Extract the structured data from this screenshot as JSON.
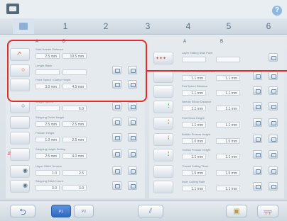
{
  "tabs": [
    {
      "label": "1"
    },
    {
      "label": "2"
    },
    {
      "label": "3"
    },
    {
      "label": "4"
    },
    {
      "label": "5"
    },
    {
      "label": "6"
    }
  ],
  "help_label": "?",
  "columns": {
    "a": "A",
    "b": "B"
  },
  "left_rows": [
    {
      "label": "Start Needle Distance",
      "a": "2.5 mm",
      "b": "10.5 mm"
    },
    {
      "label": "Length Blank",
      "a": "",
      "b": ""
    },
    {
      "label": "Feed Speed / Clamp Height",
      "a": "3.0 mm",
      "b": "4.5 mm"
    },
    {
      "label": "Margin Speed",
      "a": "",
      "b": "6.0"
    },
    {
      "label": "Stepping Guide Height",
      "a": "2.5 mm",
      "b": "2.5 mm"
    },
    {
      "label": "Presser Height",
      "a": "1.0 mm",
      "b": "2.5 mm"
    },
    {
      "label": "Stepping Height Setting",
      "a": "2.5 mm",
      "b": "4.0 mm"
    },
    {
      "label": "Upper Stitch Tension",
      "a": "1.0",
      "b": "2.5"
    },
    {
      "label": "Stepping Stitch Count",
      "a": "3.0",
      "b": "3.0"
    }
  ],
  "right_rows": [
    {
      "label": "Layer Setting Start Point",
      "a": "",
      "b": ""
    },
    {
      "label": "Thread Tension Correction",
      "a": "1.1 mm",
      "b": "1.1 mm"
    },
    {
      "label": "Fed Speed Distance",
      "a": "1.1 mm",
      "b": "1.1 mm"
    },
    {
      "label": "Needle Elbow Distance",
      "a": "1.1 mm",
      "b": "1.1 mm"
    },
    {
      "label": "Fed Elbow Height",
      "a": "1.1 mm",
      "b": "1.1 mm"
    },
    {
      "label": "Bobbin Presser Height",
      "a": "1.0 mm",
      "b": "1.5 mm"
    },
    {
      "label": "Thread Presser Height",
      "a": "1.1 mm",
      "b": "1.1 mm"
    },
    {
      "label": "Thread Cutting Timer",
      "a": "1.5 mm",
      "b": "1.5 mm"
    },
    {
      "label": "Inner Cutting Rate",
      "a": "1.1 mm",
      "b": "1.1 mm"
    }
  ],
  "bottom": {
    "p1": "P1",
    "p2": "P2"
  }
}
